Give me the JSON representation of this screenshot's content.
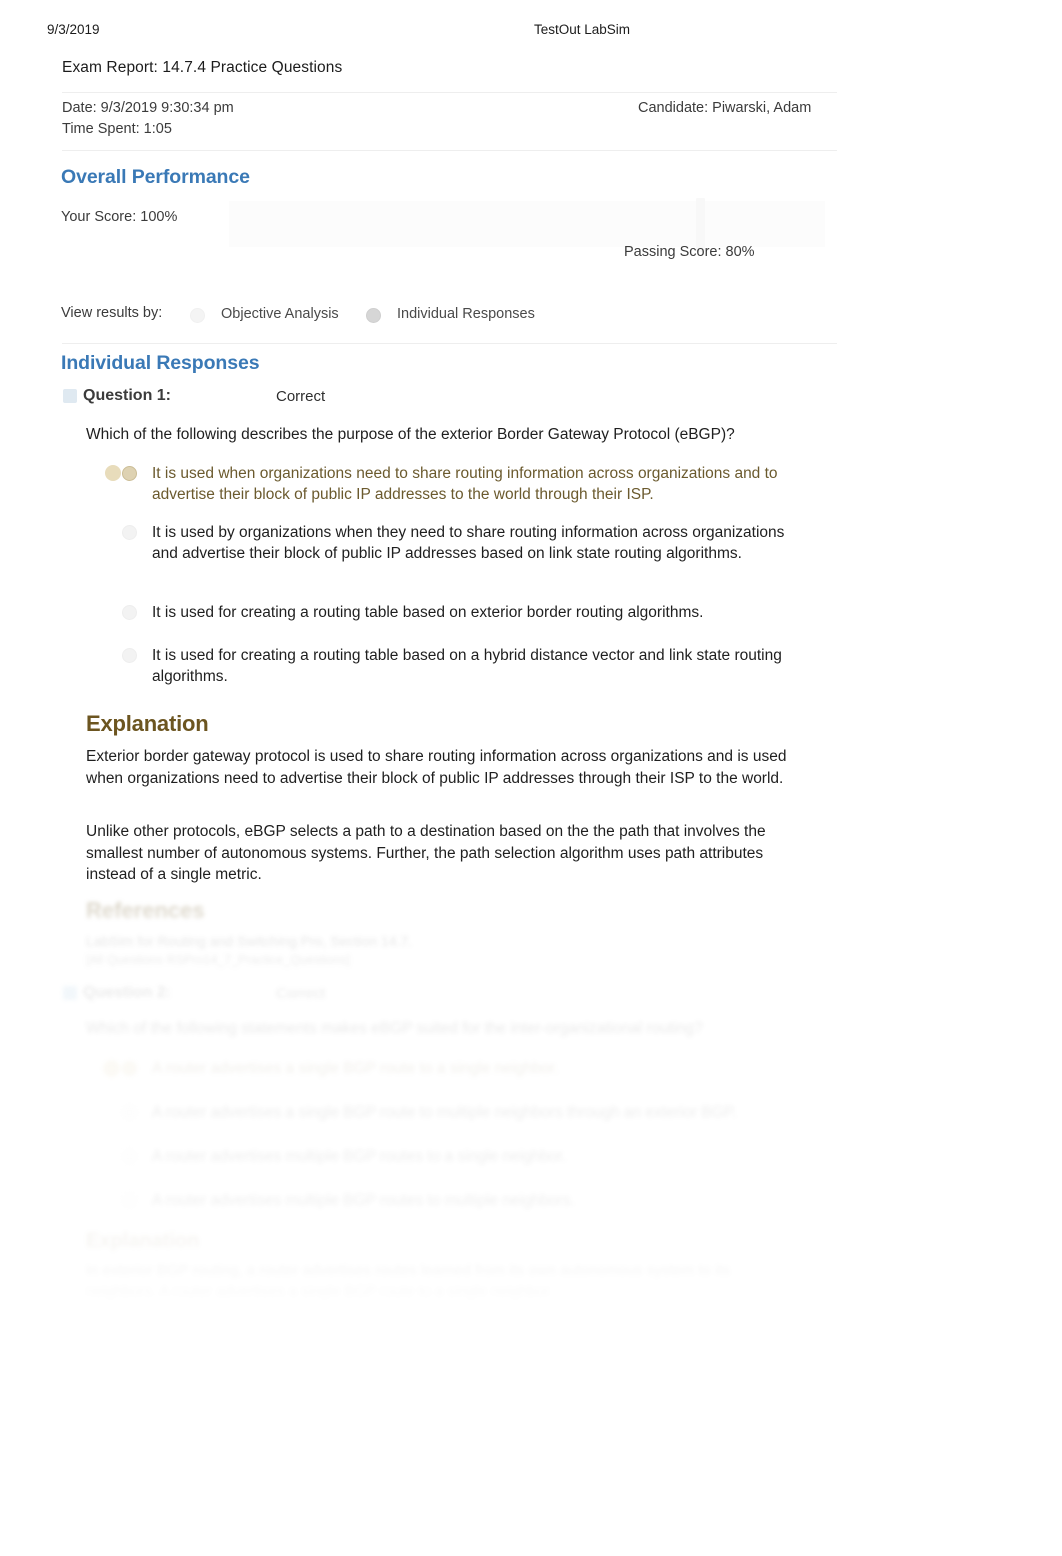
{
  "print_header": {
    "date": "9/3/2019",
    "app_name": "TestOut LabSim"
  },
  "report": {
    "title": "Exam Report: 14.7.4 Practice Questions",
    "date_line": "Date: 9/3/2019 9:30:34 pm",
    "time_spent_line": "Time Spent: 1:05",
    "candidate_line": "Candidate: Piwarski, Adam"
  },
  "overall_performance": {
    "heading": "Overall Performance",
    "your_score_label": "Your Score: 100%",
    "passing_score_label": "Passing Score: 80%",
    "your_score_percent": 100,
    "passing_score_percent": 80
  },
  "view_results": {
    "label": "View results by:",
    "options": [
      {
        "label": "Objective Analysis",
        "selected": false
      },
      {
        "label": "Individual Responses",
        "selected": true
      }
    ]
  },
  "individual_responses": {
    "heading": "Individual Responses",
    "questions": [
      {
        "label": "Question 1:",
        "status": "Correct",
        "prompt": "Which of the following describes the purpose of the exterior Border Gateway Protocol (eBGP)?",
        "options": [
          {
            "text": "It is used when organizations need to share routing information across organizations and to advertise their block of public IP addresses to the world through their ISP.",
            "correct": true
          },
          {
            "text": "It is used by organizations when they need to share routing information across organizations and advertise their block of public IP addresses based on link state routing algorithms.",
            "correct": false
          },
          {
            "text": "It is used for creating a routing table based on exterior border routing algorithms.",
            "correct": false
          },
          {
            "text": "It is used for creating a routing table based on a hybrid distance vector and link state routing algorithms.",
            "correct": false
          }
        ],
        "explanation_heading": "Explanation",
        "explanation_paragraphs": [
          "Exterior border gateway protocol is used to share routing information across organizations and is used when organizations need to advertise their block of public IP addresses through their ISP to the world.",
          "Unlike other protocols, eBGP selects a path to a destination based on the the path that involves the smallest number of autonomous systems. Further, the path selection algorithm uses path attributes instead of a single metric."
        ],
        "references_heading": "References",
        "references_lines": [
          "LabSim for Routing and Switching Pro, Section 14.7.",
          "[All Questions RSPro14_7_Practice_Questions]"
        ]
      },
      {
        "label": "Question 2:",
        "status": "Correct",
        "prompt": "Which of the following statements makes eBGP suited for the inter-organizational routing?",
        "options": [
          {
            "text": "A router advertises a single BGP route to a single neighbor.",
            "correct": true
          },
          {
            "text": "A router advertises a single BGP route to multiple neighbors through an exterior BGP.",
            "correct": false
          },
          {
            "text": "A router advertises multiple BGP routes to a single neighbor.",
            "correct": false
          },
          {
            "text": "A router advertises multiple BGP routes to multiple neighbors.",
            "correct": false
          }
        ],
        "explanation_heading": "Explanation",
        "explanation_paragraphs": [
          "In exterior BGP routing, a router advertises routes learned from its own autonomous system to its neighbors. A router advertises a single BGP route to a single neighbor."
        ]
      }
    ]
  },
  "colors": {
    "heading_blue": "#3a79b6",
    "heading_brown": "#6c5520",
    "correct_answer_text": "#6b5a2e",
    "body_text": "#1f1f1f",
    "page_background": "#ffffff"
  }
}
